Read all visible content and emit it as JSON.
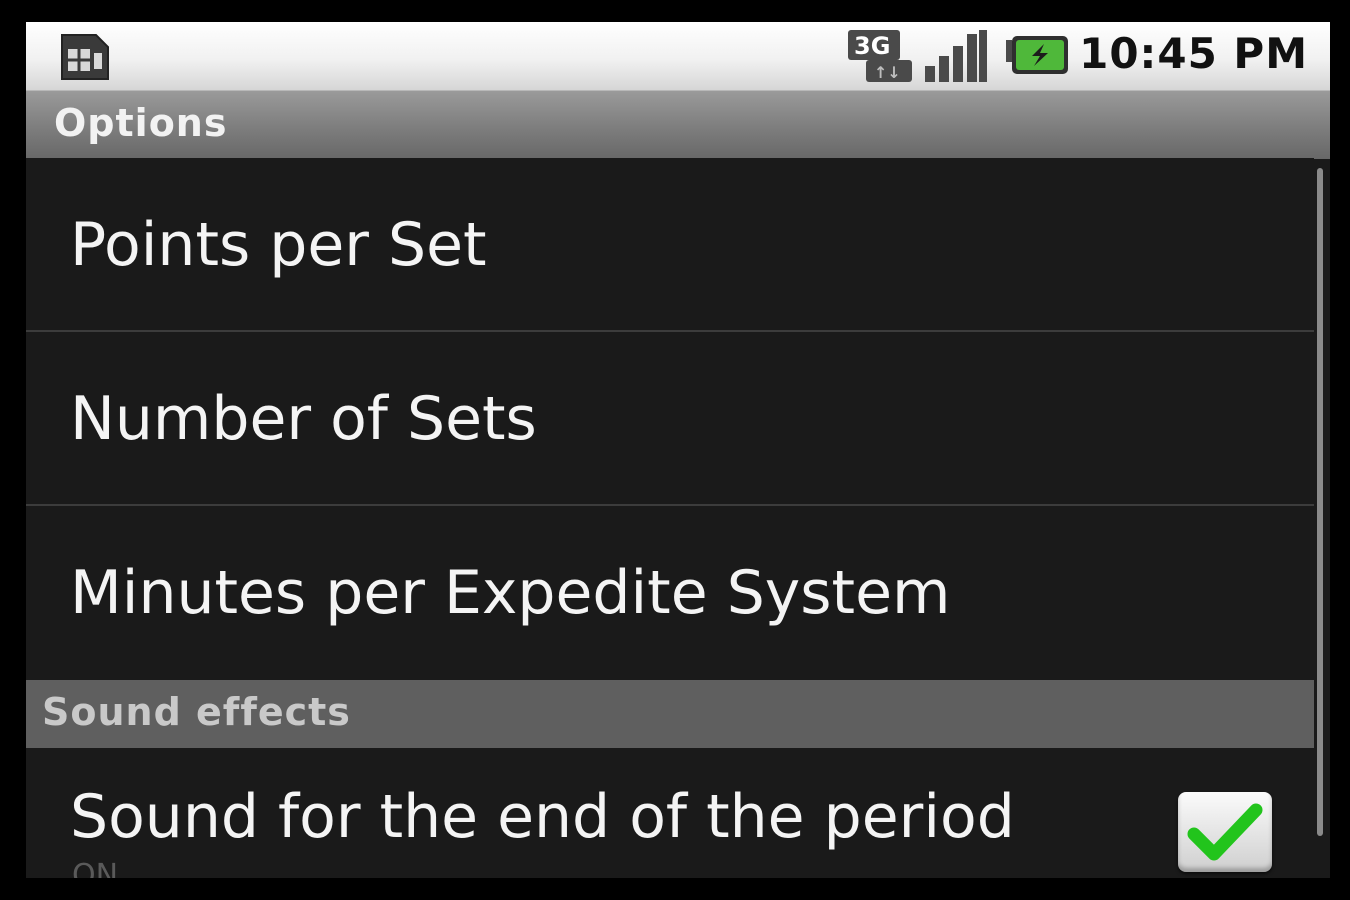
{
  "status_bar": {
    "network_badge_top": "3G",
    "network_badge_bottom": "↑↓",
    "time": "10:45 PM",
    "icons": [
      "sim-card-icon",
      "3g-icon",
      "signal-icon",
      "battery-charging-icon"
    ]
  },
  "title_bar": {
    "title": "Options"
  },
  "preferences": {
    "items": [
      {
        "label": "Points per Set"
      },
      {
        "label": "Number of Sets"
      },
      {
        "label": "Minutes per Expedite System"
      }
    ],
    "sound_category": "Sound effects",
    "sound_item": {
      "label": "Sound for the end of the period",
      "summary": "ON",
      "checked": true
    }
  },
  "colors": {
    "background": "#1a1a1a",
    "check_green": "#22c41c"
  }
}
